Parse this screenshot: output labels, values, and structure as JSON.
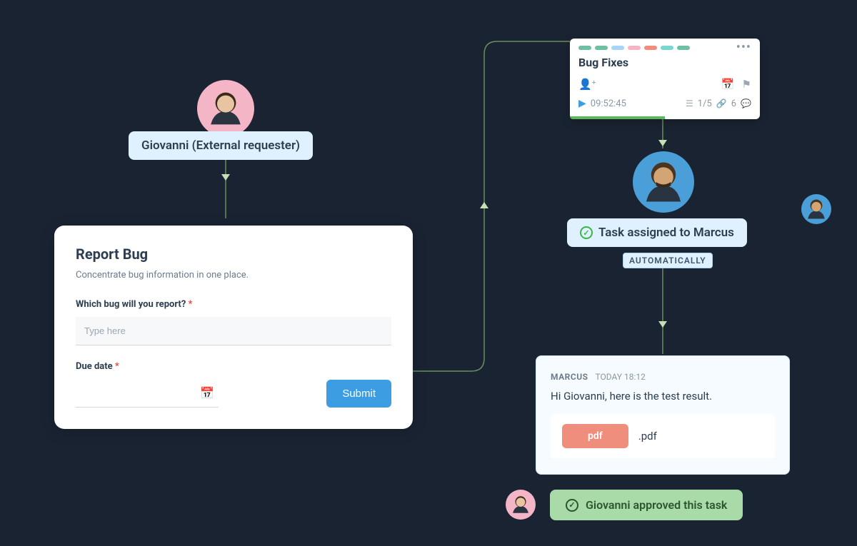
{
  "requester": {
    "label": "Giovanni (External requester)"
  },
  "form": {
    "title": "Report Bug",
    "subtitle": "Concentrate bug information in one place.",
    "q1_label": "Which bug will you report?",
    "q1_placeholder": "Type here",
    "due_label": "Due date",
    "submit": "Submit"
  },
  "task_card": {
    "title": "Bug Fixes",
    "timer": "09:52:45",
    "checklist": "1/5",
    "attachments": "6",
    "chips": [
      "#6fbfa0",
      "#6fbfa0",
      "#a8d5f7",
      "#f4b6c7",
      "#f08e7e",
      "#79d6d0",
      "#6fbfa0"
    ]
  },
  "assignment": {
    "label": "Task assigned to Marcus",
    "auto_badge": "AUTOMATICALLY"
  },
  "chat": {
    "author": "MARCUS",
    "time": "TODAY 18:12",
    "body": "Hi Giovanni, here is the test result.",
    "file_badge": "pdf",
    "file_ext": ".pdf"
  },
  "approval": {
    "text": "Giovanni approved this task"
  }
}
